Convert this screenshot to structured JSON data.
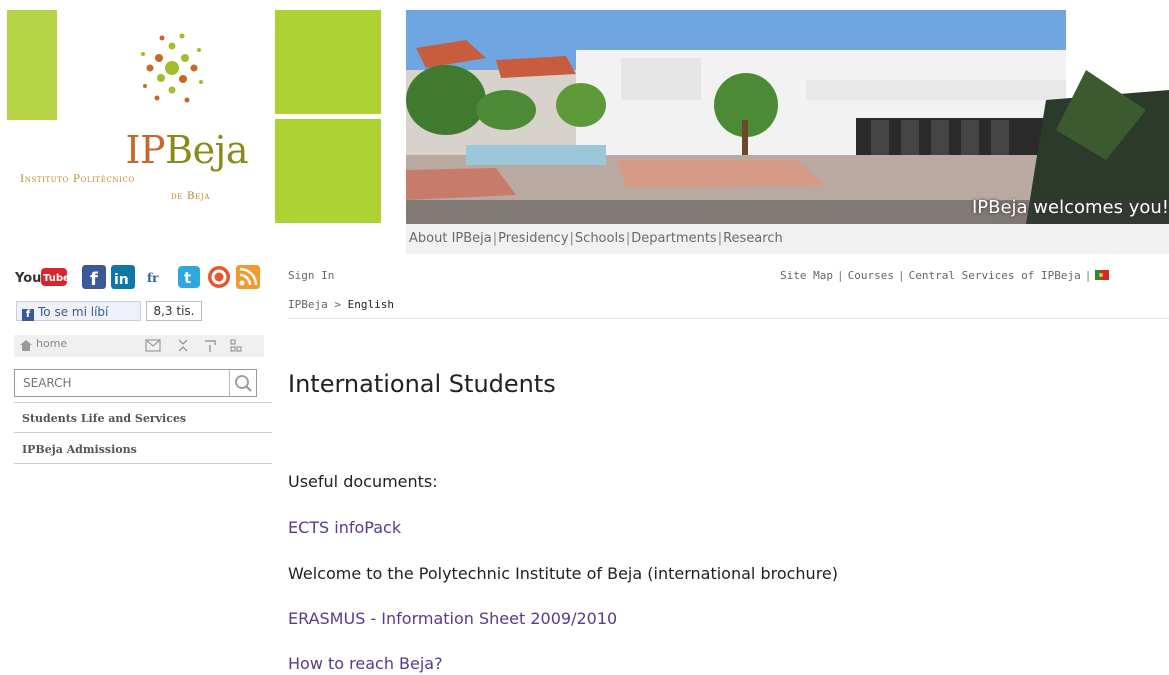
{
  "header": {
    "logo_name_accent": "IP",
    "logo_name_rest": "Beja",
    "logo_subtitle_line1": "Instituto Politécnico",
    "logo_subtitle_line2": "de Beja",
    "banner_caption": "IPBeja welcomes you!",
    "brand_green": "#aed234"
  },
  "top_nav": {
    "items": [
      "About IPBeja",
      "Presidency",
      "Schools",
      "Departments",
      "Research"
    ]
  },
  "sidebar": {
    "social_icons": [
      "youtube-icon",
      "facebook-icon",
      "linkedin-icon",
      "fr-icon",
      "twitter-icon",
      "circle-icon",
      "rss-icon"
    ],
    "fb_like_label": "To se mi líbí",
    "fb_like_count": "8,3 tis.",
    "home_label": "home",
    "search_placeholder": "SEARCH",
    "items": [
      "Students Life and Services",
      "IPBeja Admissions"
    ]
  },
  "utility": {
    "sign_in": "Sign In",
    "links": [
      "Site Map",
      "Courses",
      "Central Services of IPBeja"
    ]
  },
  "breadcrumb": {
    "root": "IPBeja",
    "separator": ">",
    "current": "English"
  },
  "main": {
    "title": "International Students",
    "intro": "Useful documents:",
    "documents": [
      {
        "label": "ECTS infoPack",
        "link": true
      },
      {
        "label": "Welcome to the Polytechnic Institute of Beja (international brochure)",
        "link": false
      },
      {
        "label": "ERASMUS - Information Sheet 2009/2010",
        "link": true
      },
      {
        "label": "How to reach Beja?",
        "link": true
      }
    ]
  }
}
